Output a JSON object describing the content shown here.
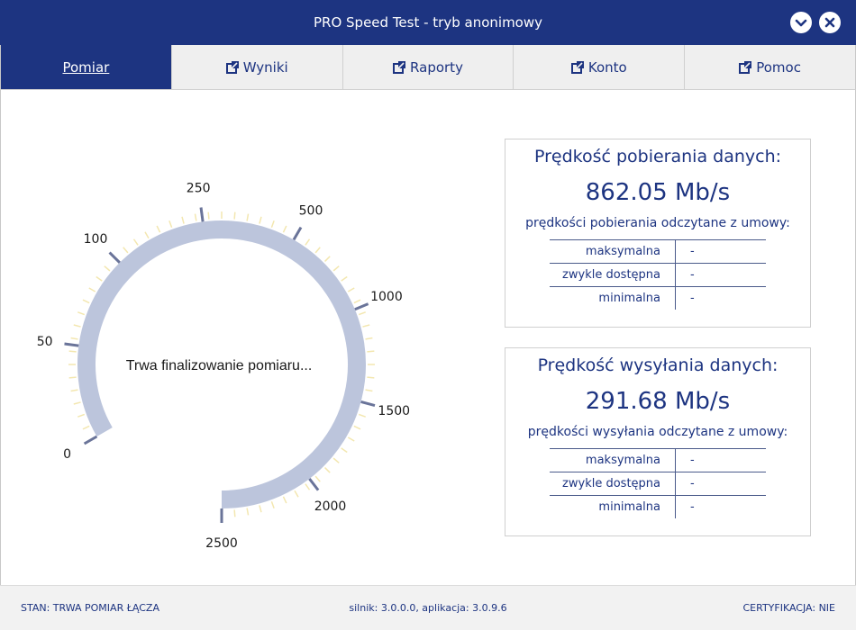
{
  "window": {
    "title": "PRO Speed Test - tryb anonimowy",
    "minimize_icon": "chevron-down-icon",
    "close_icon": "close-icon"
  },
  "tabs": [
    {
      "label": "Pomiar",
      "active": true,
      "icon": ""
    },
    {
      "label": "Wyniki",
      "active": false,
      "icon": "external-link-icon"
    },
    {
      "label": "Raporty",
      "active": false,
      "icon": "external-link-icon"
    },
    {
      "label": "Konto",
      "active": false,
      "icon": "external-link-icon"
    },
    {
      "label": "Pomoc",
      "active": false,
      "icon": "external-link-icon"
    }
  ],
  "gauge": {
    "status_text": "Trwa finalizowanie pomiaru...",
    "scale_labels": [
      "0",
      "50",
      "100",
      "250",
      "500",
      "1000",
      "1500",
      "2000",
      "2500"
    ],
    "progress": 1.0,
    "colors": {
      "arc": "#bcc5dc",
      "major_tick": "#6a7499",
      "minor_tick": "#f3e7b0"
    }
  },
  "download": {
    "title": "Prędkość pobierania danych:",
    "value": "862.05 Mb/s",
    "subtitle": "prędkości pobierania odczytane z umowy:",
    "rows": [
      {
        "label": "maksymalna",
        "value": "-"
      },
      {
        "label": "zwykle dostępna",
        "value": "-"
      },
      {
        "label": "minimalna",
        "value": "-"
      }
    ]
  },
  "upload": {
    "title": "Prędkość wysyłania danych:",
    "value": "291.68 Mb/s",
    "subtitle": "prędkości wysyłania odczytane z umowy:",
    "rows": [
      {
        "label": "maksymalna",
        "value": "-"
      },
      {
        "label": "zwykle dostępna",
        "value": "-"
      },
      {
        "label": "minimalna",
        "value": "-"
      }
    ]
  },
  "statusbar": {
    "state": "STAN: TRWA POMIAR ŁĄCZA",
    "version": "silnik: 3.0.0.0, aplikacja: 3.0.9.6",
    "certification": "CERTYFIKACJA: NIE"
  },
  "colors": {
    "brand": "#1d3481",
    "tab_bg": "#efefef",
    "status_bg": "#f2f2f2"
  }
}
